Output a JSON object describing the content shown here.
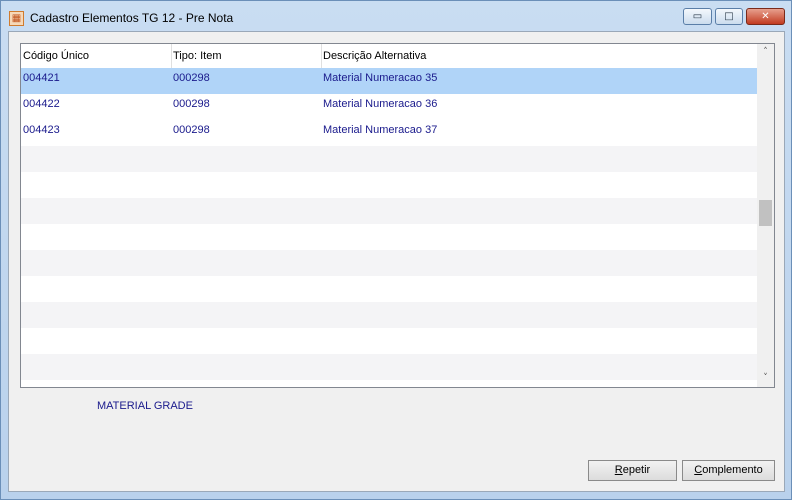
{
  "window": {
    "title": "Cadastro Elementos TG 12 - Pre Nota",
    "app_icon": "app-icon",
    "controls": {
      "minimize": "▭",
      "maximize": "□",
      "close": "✕"
    }
  },
  "grid": {
    "columns": [
      "Código Único",
      "Tipo: Item",
      "Descrição Alternativa"
    ],
    "rows": [
      {
        "codigo": "004421",
        "tipo": "000298",
        "descricao": "Material Numeracao 35",
        "selected": true
      },
      {
        "codigo": "004422",
        "tipo": "000298",
        "descricao": "Material Numeracao 36",
        "selected": false
      },
      {
        "codigo": "004423",
        "tipo": "000298",
        "descricao": "Material Numeracao 37",
        "selected": false
      }
    ],
    "scroll_up": "˄",
    "scroll_down": "˅"
  },
  "footer": {
    "material_label": "MATERIAL GRADE",
    "repetir_label": "Repetir",
    "complemento_label": "Complemento"
  },
  "colors": {
    "selection": "#b0d4f8",
    "row_text": "#1a1a8c",
    "stripe": "#f4f4f6"
  }
}
